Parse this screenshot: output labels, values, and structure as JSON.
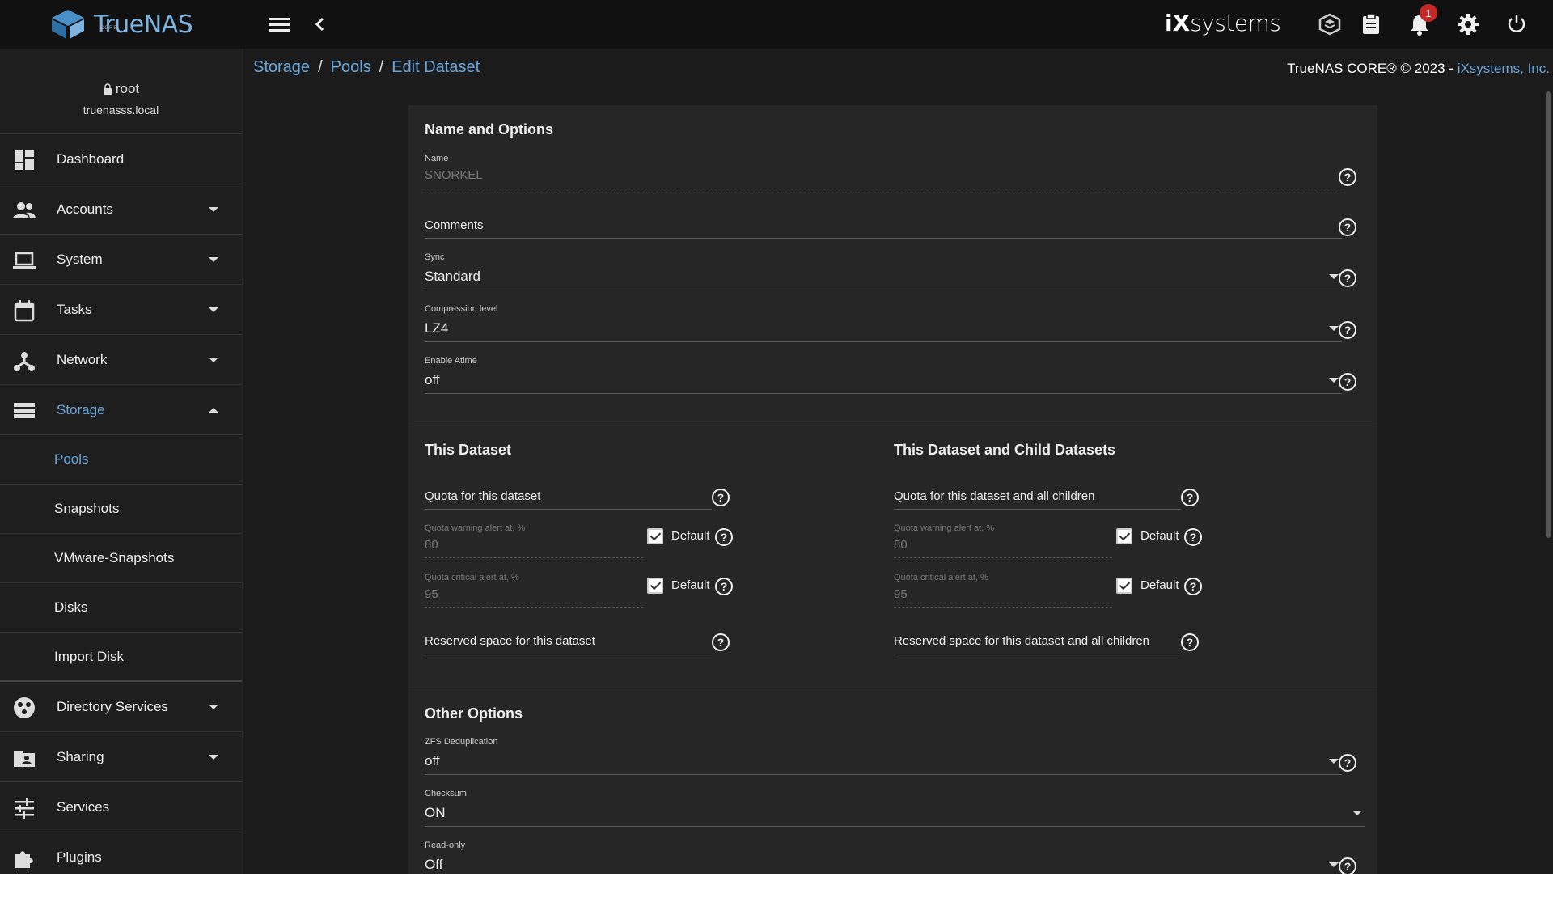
{
  "app": {
    "logo_text": "TrueNAS",
    "logo_sub": "CORE",
    "vendor_i": "iX",
    "vendor_rest": "systems",
    "notification_count": "1"
  },
  "user": {
    "name": "root",
    "host": "truenasss.local"
  },
  "sidebar": {
    "items": [
      {
        "label": "Dashboard"
      },
      {
        "label": "Accounts"
      },
      {
        "label": "System"
      },
      {
        "label": "Tasks"
      },
      {
        "label": "Network"
      },
      {
        "label": "Storage"
      }
    ],
    "storage_sub": [
      {
        "label": "Pools"
      },
      {
        "label": "Snapshots"
      },
      {
        "label": "VMware-Snapshots"
      },
      {
        "label": "Disks"
      },
      {
        "label": "Import Disk"
      }
    ],
    "items_after": [
      {
        "label": "Directory Services"
      },
      {
        "label": "Sharing"
      },
      {
        "label": "Services"
      },
      {
        "label": "Plugins"
      }
    ]
  },
  "breadcrumb": {
    "b1": "Storage",
    "b2": "Pools",
    "b3": "Edit Dataset",
    "sep": "/"
  },
  "copyright": {
    "text": "TrueNAS CORE® © 2023 - ",
    "link": "iXsystems, Inc."
  },
  "form": {
    "name_options": {
      "title": "Name and Options",
      "name_label": "Name",
      "name_value": "SNORKEL",
      "comments_label": "Comments",
      "sync_label": "Sync",
      "sync_value": "Standard",
      "compression_label": "Compression level",
      "compression_value": "LZ4",
      "atime_label": "Enable Atime",
      "atime_value": "off"
    },
    "this_dataset": {
      "title": "This Dataset",
      "quota_label": "Quota for this dataset",
      "warn_label": "Quota warning alert at, %",
      "warn_value": "80",
      "crit_label": "Quota critical alert at, %",
      "crit_value": "95",
      "default_label": "Default",
      "reserved_label": "Reserved space for this dataset"
    },
    "child_datasets": {
      "title": "This Dataset and Child Datasets",
      "quota_label": "Quota for this dataset and all children",
      "warn_label": "Quota warning alert at, %",
      "warn_value": "80",
      "crit_label": "Quota critical alert at, %",
      "crit_value": "95",
      "default_label": "Default",
      "reserved_label": "Reserved space for this dataset and all children"
    },
    "other": {
      "title": "Other Options",
      "dedup_label": "ZFS Deduplication",
      "dedup_value": "off",
      "checksum_label": "Checksum",
      "checksum_value": "ON",
      "readonly_label": "Read-only",
      "readonly_value": "Off"
    }
  }
}
